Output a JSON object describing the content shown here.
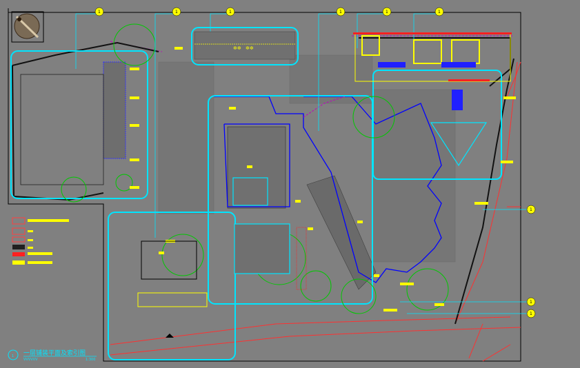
{
  "drawing": {
    "title": "一层铺装平面及索引图",
    "scale_left": "VVVVVV",
    "scale_right": "1:300",
    "title_number": "1"
  },
  "colors": {
    "background": "#808080",
    "cyan": "#00e5ff",
    "blue": "#0000ff",
    "yellow": "#ffff00",
    "green": "#00c800",
    "red": "#ff2020",
    "magenta": "#c000c0",
    "black": "#000000",
    "pink": "#ff9999"
  },
  "callouts_top": [
    "1",
    "1",
    "1",
    "1",
    "1",
    "1"
  ],
  "callouts_right": [
    "1",
    "1",
    "1"
  ],
  "legend_items": [
    "",
    "",
    "",
    "",
    "",
    ""
  ]
}
